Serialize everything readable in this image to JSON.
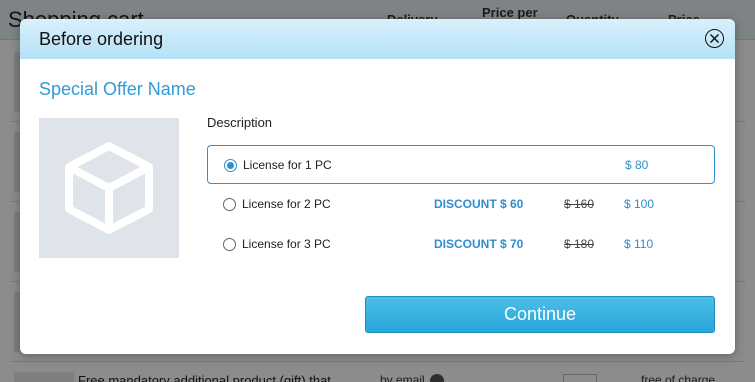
{
  "background": {
    "title": "Shopping cart",
    "columns": {
      "delivery": "Delivery",
      "price_per": "Price per",
      "quantity": "Quantity",
      "price": "Price"
    },
    "footer_item_text": "Free mandatory additional product (gift) that",
    "footer_delivery": "by email",
    "footer_price": "free of charge"
  },
  "modal": {
    "title": "Before ordering",
    "offer_name": "Special Offer Name",
    "description_label": "Description",
    "options": [
      {
        "label": "License for 1 PC",
        "discount": "",
        "old_price": "",
        "price": "$ 80",
        "selected": true
      },
      {
        "label": "License for 2 PC",
        "discount": "DISCOUNT $ 60",
        "old_price": "$ 160",
        "price": "$ 100",
        "selected": false
      },
      {
        "label": "License for 3 PC",
        "discount": "DISCOUNT $ 70",
        "old_price": "$ 180",
        "price": "$ 110",
        "selected": false
      }
    ],
    "continue_label": "Continue"
  },
  "colors": {
    "accent": "#2f8fcf",
    "header_gradient_top": "#d9f0fb",
    "header_gradient_bottom": "#b5e1f7",
    "button": "#27a5db"
  },
  "icons": {
    "close": "close-icon",
    "product": "box-icon",
    "remove": "remove-x-icon",
    "help": "question-icon"
  }
}
